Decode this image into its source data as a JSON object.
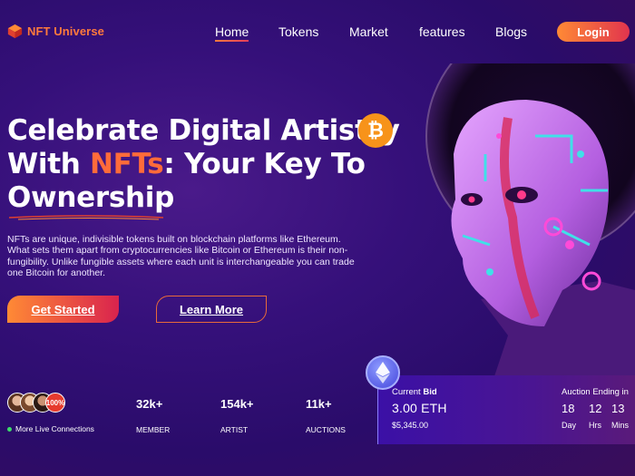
{
  "brand": {
    "name": "NFT Universe",
    "logo_icon": "cube-icon"
  },
  "nav": {
    "items": [
      {
        "label": "Home",
        "active": true
      },
      {
        "label": "Tokens"
      },
      {
        "label": "Market"
      },
      {
        "label": "features"
      },
      {
        "label": "Blogs"
      }
    ],
    "login_label": "Login"
  },
  "hero": {
    "title_line1": "Celebrate Digital Artistry",
    "title_line2_pre": "With ",
    "title_line2_accent": "NFTs",
    "title_line2_post": ": Your Key To",
    "title_line3": "Ownership",
    "badge_icon": "bitcoin-icon",
    "badge_glyph": "₿",
    "description": "NFTs are unique, indivisible tokens built on blockchain platforms like Ethereum. What sets them apart from cryptocurrencies like Bitcoin or Ethereum is their non-fungibility. Unlike fungible assets where each unit is interchangeable you can trade one Bitcoin for another.",
    "primary_cta": "Get Started",
    "secondary_cta": "Learn More"
  },
  "stats": {
    "avatar_badge": "100%",
    "live_label": "More Live Connections",
    "items": [
      {
        "value": "32k+",
        "label": "MEMBER"
      },
      {
        "value": "154k+",
        "label": "ARTIST"
      },
      {
        "value": "11k+",
        "label": "AUCTIONS"
      }
    ]
  },
  "bid": {
    "label_pre": "Current ",
    "label_bold": "Bid",
    "eth": "3.00 ETH",
    "usd": "$5,345.00",
    "auction_label": "Auction Ending in",
    "timer": [
      {
        "value": "18",
        "unit": "Day"
      },
      {
        "value": "12",
        "unit": "Hrs"
      },
      {
        "value": "13",
        "unit": "Mins"
      }
    ]
  },
  "colors": {
    "accent": "#ff6b3a",
    "brand_gradient_start": "#ff8a35",
    "brand_gradient_end": "#d9234e",
    "background": "#35107a"
  }
}
